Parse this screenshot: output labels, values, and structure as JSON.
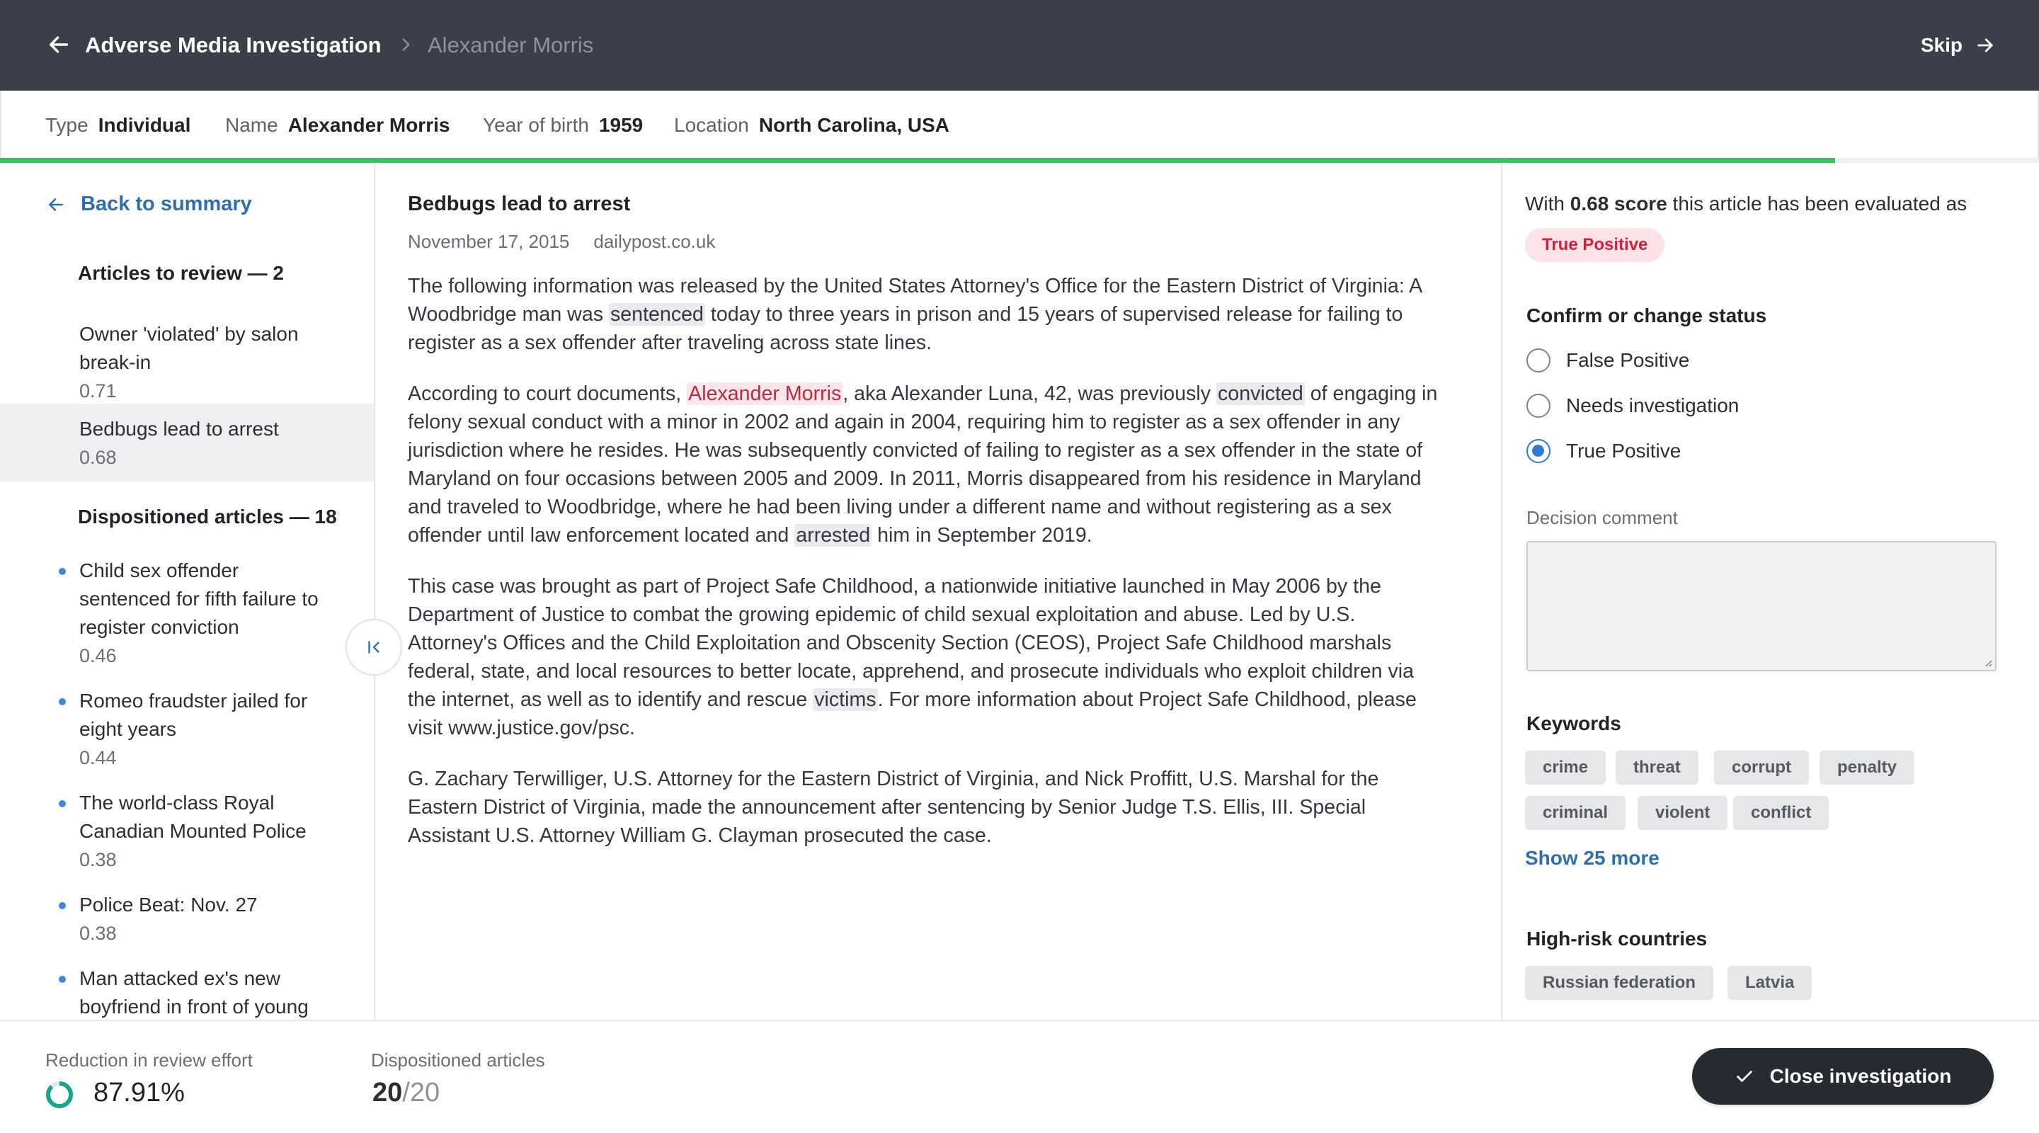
{
  "header": {
    "title": "Adverse Media Investigation",
    "subject": "Alexander Morris",
    "skip_label": "Skip",
    "back_icon": "arrow-left-icon",
    "skip_icon": "arrow-right-icon"
  },
  "subject_info": {
    "type_label": "Type",
    "type_value": "Individual",
    "name_label": "Name",
    "name_value": "Alexander Morris",
    "yob_label": "Year of birth",
    "yob_value": "1959",
    "location_label": "Location",
    "location_value": "North Carolina, USA",
    "progress_fraction": 0.9
  },
  "sidebar": {
    "back_label": "Back to summary",
    "review_heading": "Articles to review — 2",
    "review_items": [
      {
        "title": "Owner 'violated' by salon break-in",
        "score": "0.71"
      },
      {
        "title": "Bedbugs lead to arrest",
        "score": "0.68"
      }
    ],
    "dispositioned_heading": "Dispositioned articles — 18",
    "dispositioned_items": [
      {
        "title": "Child sex offender sentenced for fifth failure to register conviction",
        "score": "0.46"
      },
      {
        "title": "Romeo fraudster jailed for eight years",
        "score": "0.44"
      },
      {
        "title": "The world-class Royal Canadian Mounted Police",
        "score": "0.38"
      },
      {
        "title": "Police Beat: Nov. 27",
        "score": "0.38"
      },
      {
        "title": "Man attacked ex's new boyfriend in front of young",
        "score": ""
      }
    ]
  },
  "article": {
    "title": "Bedbugs lead to arrest",
    "date": "November 17, 2015",
    "source": "dailypost.co.uk",
    "p1": {
      "a": "The following information was released by the United States Attorney's Office for the Eastern District of Virginia: A Woodbridge man was ",
      "h1": "sentenced",
      "b": " today to three years in prison and 15 years of supervised release for failing to register as a sex offender after traveling across state lines."
    },
    "p2": {
      "a": "According to court documents, ",
      "name": "Alexander Morris",
      "b": ", aka Alexander Luna, 42, was previously ",
      "h1": "convicted",
      "c": " of engaging in felony sexual conduct with a minor in 2002 and again in 2004, requiring him to register as a sex offender in any jurisdiction where he resides. He was subsequently convicted of failing to register as a sex offender in the state of Maryland on four occasions between 2005 and 2009. In 2011, Morris disappeared from his residence in Maryland and traveled to Woodbridge, where he had been living under a different name and without registering as a sex offender until law enforcement located and ",
      "h2": "arrested",
      "d": " him in September 2019."
    },
    "p3": {
      "a": "This case was brought as part of Project Safe Childhood, a nationwide initiative launched in May 2006 by the Department of Justice to combat the growing epidemic of child sexual exploitation and abuse. Led by U.S. Attorney's Offices and the Child Exploitation and Obscenity Section (CEOS), Project Safe Childhood marshals federal, state, and local resources to better locate, apprehend, and prosecute individuals who exploit children via the internet, as well as to identify and rescue ",
      "h1": "victims",
      "b": ". For more information about Project Safe Childhood, please visit www.justice.gov/psc."
    },
    "p4": "G. Zachary Terwilliger, U.S. Attorney for the Eastern District of Virginia, and Nick Proffitt, U.S. Marshal for the Eastern District of Virginia, made the announcement after sentencing by Senior Judge T.S. Ellis, III. Special Assistant U.S. Attorney William G. Clayman prosecuted the case."
  },
  "evaluation": {
    "prefix": "With ",
    "score": "0.68 score",
    "suffix": " this article has been evaluated as",
    "badge": "True Positive",
    "status_heading": "Confirm or change status",
    "options": [
      "False Positive",
      "Needs investigation",
      "True Positive"
    ],
    "selected": "True Positive",
    "comment_label": "Decision comment",
    "comment_value": "",
    "keywords_heading": "Keywords",
    "keywords": [
      "crime",
      "threat",
      "corrupt",
      "penalty",
      "criminal",
      "violent",
      "conflict"
    ],
    "show_more": "Show 25 more",
    "countries_heading": "High-risk countries",
    "countries": [
      "Russian federation",
      "Latvia"
    ]
  },
  "footer": {
    "reduction_label": "Reduction in review effort",
    "reduction_value": "87.91%",
    "reduction_fraction": 0.8791,
    "dispositioned_label": "Dispositioned articles",
    "dispositioned_count": "20",
    "dispositioned_total": "/20",
    "close_label": "Close investigation"
  },
  "colors": {
    "topbar": "#3a3f4a",
    "accent_blue": "#2f6fb0",
    "progress_green": "#3fbf62",
    "badge_red": "#d21f3c",
    "ring_green": "#19a58a"
  }
}
